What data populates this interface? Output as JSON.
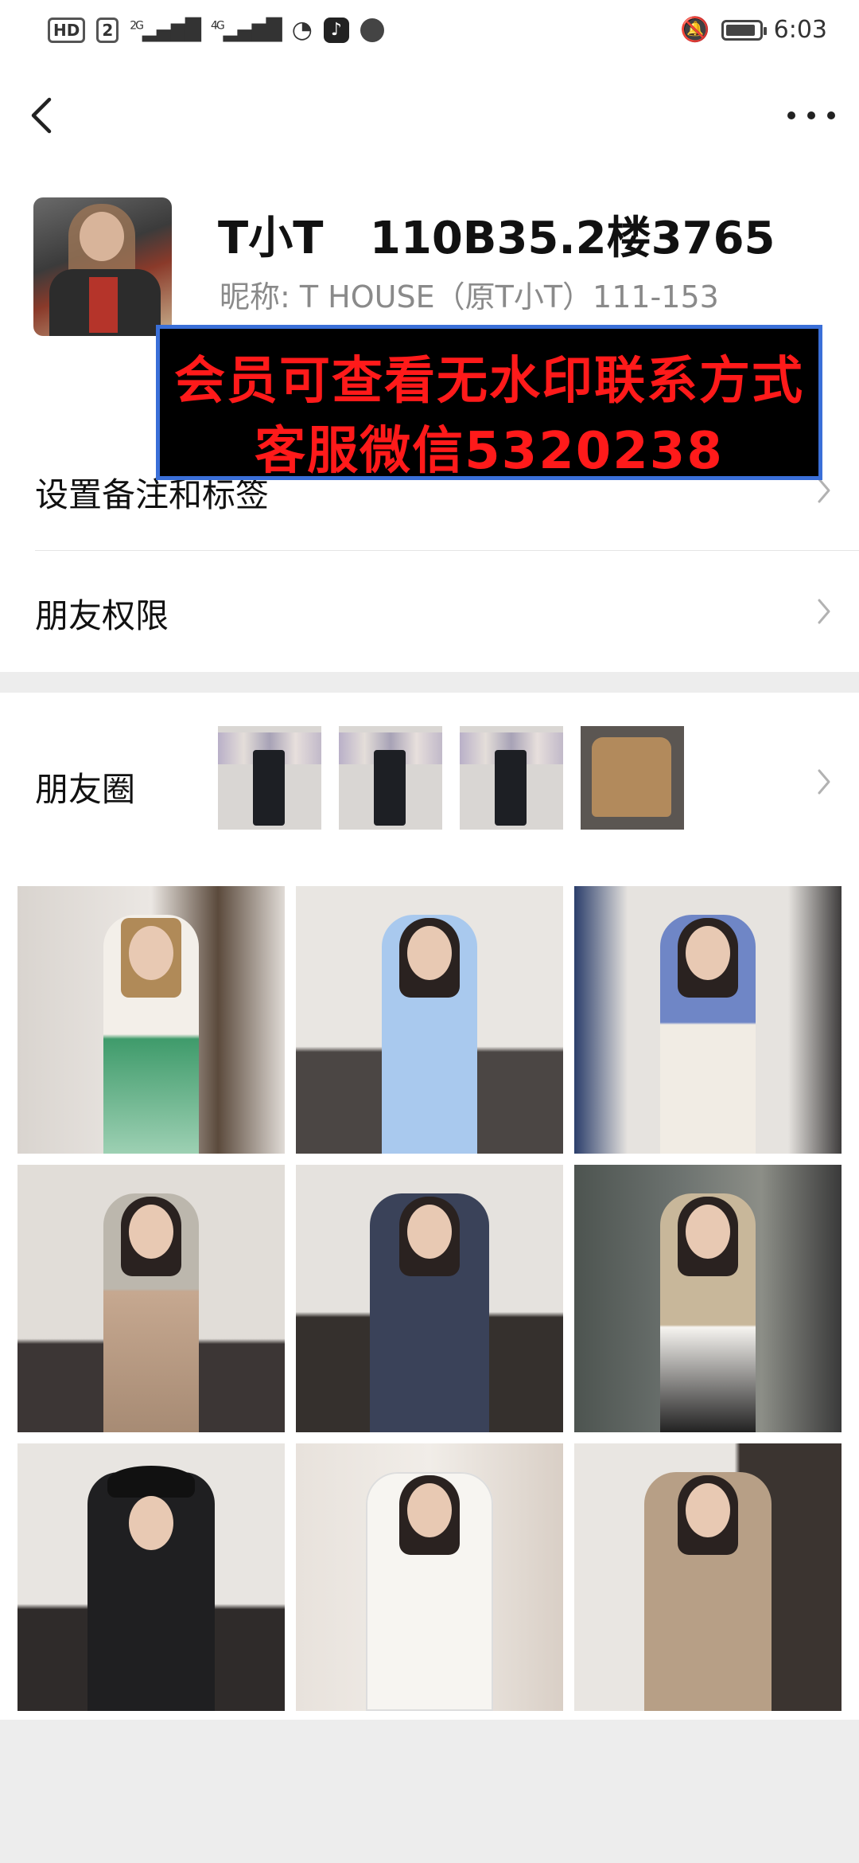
{
  "status_bar": {
    "hd": "HD",
    "sim": "2",
    "net1": "2G",
    "net2": "4G",
    "time": "6:03",
    "battery_level": 0.9
  },
  "header": {
    "back_icon": "chevron-left-icon",
    "more_icon": "more-dots-icon"
  },
  "profile": {
    "name": "T小T   110B35.2楼3765",
    "nickname": "昵称: T HOUSE（原T小T）111-153"
  },
  "watermark": {
    "line1": "会员可查看无水印联系方式",
    "line2": "客服微信5320238"
  },
  "rows": [
    {
      "label": "设置备注和标签"
    },
    {
      "label": "朋友权限"
    }
  ],
  "moments": {
    "label": "朋友圈"
  },
  "colors": {
    "banner_bg": "#000000",
    "banner_text": "#ff1a1a",
    "banner_border": "#3a6fd8"
  }
}
